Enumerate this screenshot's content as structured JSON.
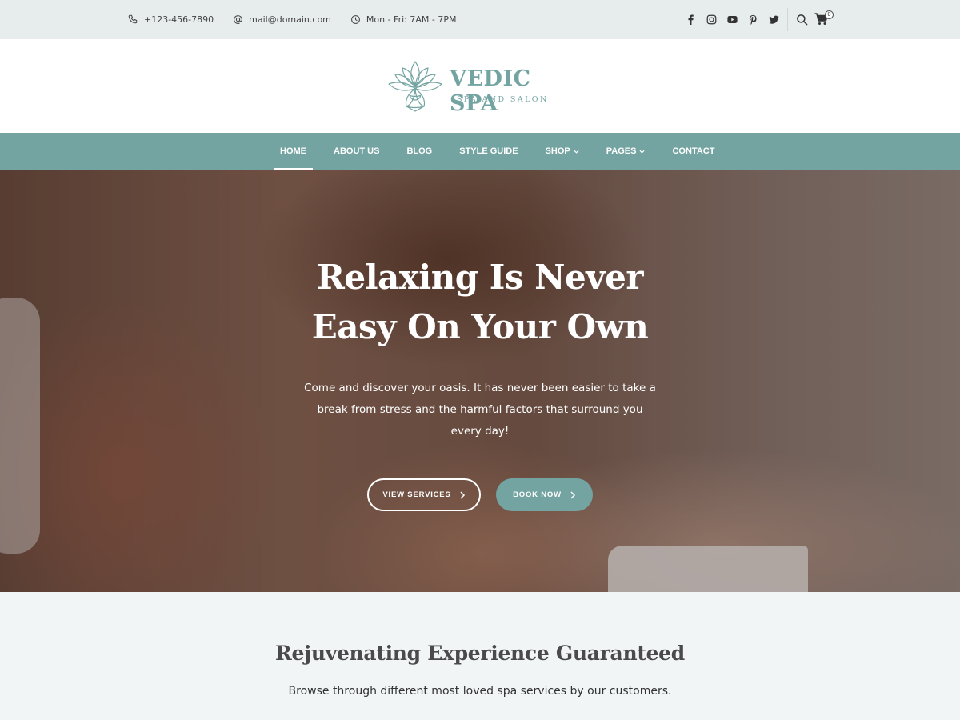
{
  "topbar": {
    "phone": "+123-456-7890",
    "email": "mail@domain.com",
    "hours": "Mon - Fri: 7AM - 7PM",
    "social_icons": [
      "facebook-icon",
      "instagram-icon",
      "youtube-icon",
      "pinterest-icon",
      "twitter-icon"
    ],
    "cart_count": "0"
  },
  "logo": {
    "name": "VEDIC SPA",
    "tagline": "SPA AND SALON"
  },
  "nav": {
    "items": [
      {
        "label": "HOME",
        "active": true
      },
      {
        "label": "ABOUT US"
      },
      {
        "label": "BLOG"
      },
      {
        "label": "STYLE GUIDE"
      },
      {
        "label": "SHOP",
        "dropdown": true
      },
      {
        "label": "PAGES",
        "dropdown": true
      },
      {
        "label": "CONTACT"
      }
    ]
  },
  "hero": {
    "title_line1": "Relaxing Is Never",
    "title_line2": "Easy On Your Own",
    "description": "Come and discover your oasis. It has never been easier to take a break from stress and the harmful factors that surround you every day!",
    "btn_services": "VIEW SERVICES",
    "btn_book": "BOOK NOW"
  },
  "section": {
    "title": "Rejuvenating Experience Guaranteed",
    "subtitle": "Browse through different most loved spa services by our customers."
  },
  "colors": {
    "accent": "#73a4a1",
    "topbar_bg": "#e7eded",
    "section_bg": "#f1f5f5"
  }
}
